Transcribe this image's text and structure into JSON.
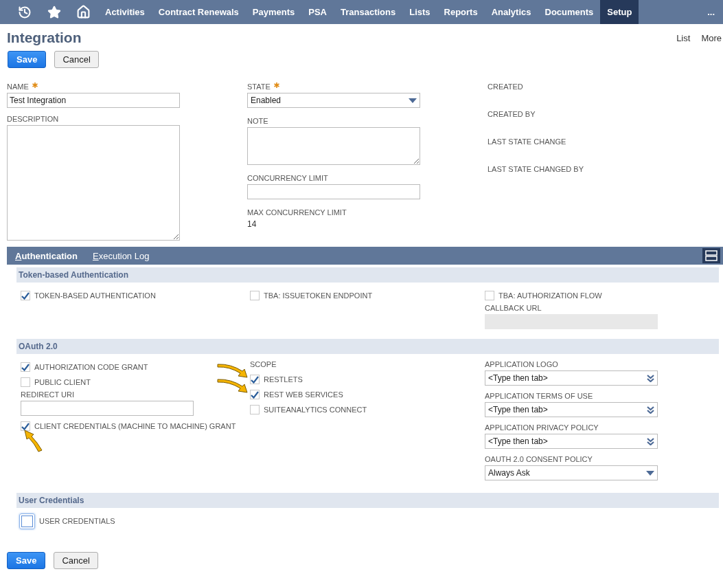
{
  "nav": {
    "items": [
      {
        "label": "Activities",
        "selected": false
      },
      {
        "label": "Contract Renewals",
        "selected": false
      },
      {
        "label": "Payments",
        "selected": false
      },
      {
        "label": "PSA",
        "selected": false
      },
      {
        "label": "Transactions",
        "selected": false
      },
      {
        "label": "Lists",
        "selected": false
      },
      {
        "label": "Reports",
        "selected": false
      },
      {
        "label": "Analytics",
        "selected": false
      },
      {
        "label": "Documents",
        "selected": false
      },
      {
        "label": "Setup",
        "selected": true
      }
    ],
    "overflow": "..."
  },
  "page": {
    "title": "Integration",
    "links": [
      "List",
      "More"
    ]
  },
  "buttons_top": [
    {
      "label": "Save",
      "primary": true
    },
    {
      "label": "Cancel",
      "primary": false
    }
  ],
  "fields": [
    [
      {
        "kind": "text",
        "label": "NAME",
        "required": true,
        "value": "Test Integration"
      },
      {
        "kind": "textarea",
        "label": "DESCRIPTION",
        "tall": true
      }
    ],
    [
      {
        "kind": "select",
        "label": "STATE",
        "required": true,
        "value": "Enabled"
      },
      {
        "kind": "textarea",
        "label": "NOTE",
        "tall": false
      },
      {
        "kind": "text",
        "label": "CONCURRENCY LIMIT",
        "required": false
      },
      {
        "kind": "readonly",
        "label": "MAX CONCURRENCY LIMIT",
        "value": "14"
      }
    ],
    [
      {
        "kind": "info",
        "label": "CREATED"
      },
      {
        "kind": "info",
        "label": "CREATED BY"
      },
      {
        "kind": "info",
        "label": "LAST STATE CHANGE"
      },
      {
        "kind": "info",
        "label": "LAST STATE CHANGED BY"
      }
    ]
  ],
  "tabs": [
    {
      "label": "Authentication",
      "selected": true
    },
    {
      "label": "Execution Log",
      "selected": false
    }
  ],
  "sections": [
    {
      "title": "Token-based Authentication",
      "columns": [
        [
          {
            "kind": "checkbox",
            "label": "TOKEN-BASED AUTHENTICATION",
            "checked": true
          }
        ],
        [
          {
            "kind": "checkbox",
            "label": "TBA: ISSUETOKEN ENDPOINT",
            "checked": false
          }
        ],
        [
          {
            "kind": "checkbox",
            "label": "TBA: AUTHORIZATION FLOW",
            "checked": false
          },
          {
            "kind": "text",
            "label": "CALLBACK URL",
            "disabled": true
          }
        ]
      ]
    },
    {
      "title": "OAuth 2.0",
      "columns": [
        [
          {
            "kind": "checkbox",
            "label": "AUTHORIZATION CODE GRANT",
            "checked": true
          },
          {
            "kind": "checkbox",
            "label": "PUBLIC CLIENT",
            "checked": false
          },
          {
            "kind": "text",
            "label": "REDIRECT URI",
            "disabled": false
          },
          {
            "kind": "checkbox",
            "label": "CLIENT CREDENTIALS (MACHINE TO MACHINE) GRANT",
            "checked": true,
            "arrow": true
          }
        ],
        [
          {
            "kind": "heading",
            "label": "SCOPE"
          },
          {
            "kind": "checkbox",
            "label": "RESTLETS",
            "checked": true,
            "arrow": true
          },
          {
            "kind": "checkbox",
            "label": "REST WEB SERVICES",
            "checked": true,
            "arrow": true
          },
          {
            "kind": "checkbox",
            "label": "SUITEANALYTICS CONNECT",
            "checked": false
          }
        ],
        [
          {
            "kind": "lookup",
            "label": "APPLICATION LOGO",
            "value": "<Type then tab>"
          },
          {
            "kind": "lookup",
            "label": "APPLICATION TERMS OF USE",
            "value": "<Type then tab>"
          },
          {
            "kind": "lookup",
            "label": "APPLICATION PRIVACY POLICY",
            "value": "<Type then tab>"
          },
          {
            "kind": "select",
            "label": "OAUTH 2.0 CONSENT POLICY",
            "value": "Always Ask"
          }
        ]
      ]
    },
    {
      "title": "User Credentials",
      "columns": [
        [
          {
            "kind": "checkbox",
            "label": "USER CREDENTIALS",
            "checked": false,
            "focused": true
          }
        ]
      ]
    }
  ],
  "buttons_bottom": [
    {
      "label": "Save",
      "primary": true
    },
    {
      "label": "Cancel",
      "primary": false
    }
  ]
}
